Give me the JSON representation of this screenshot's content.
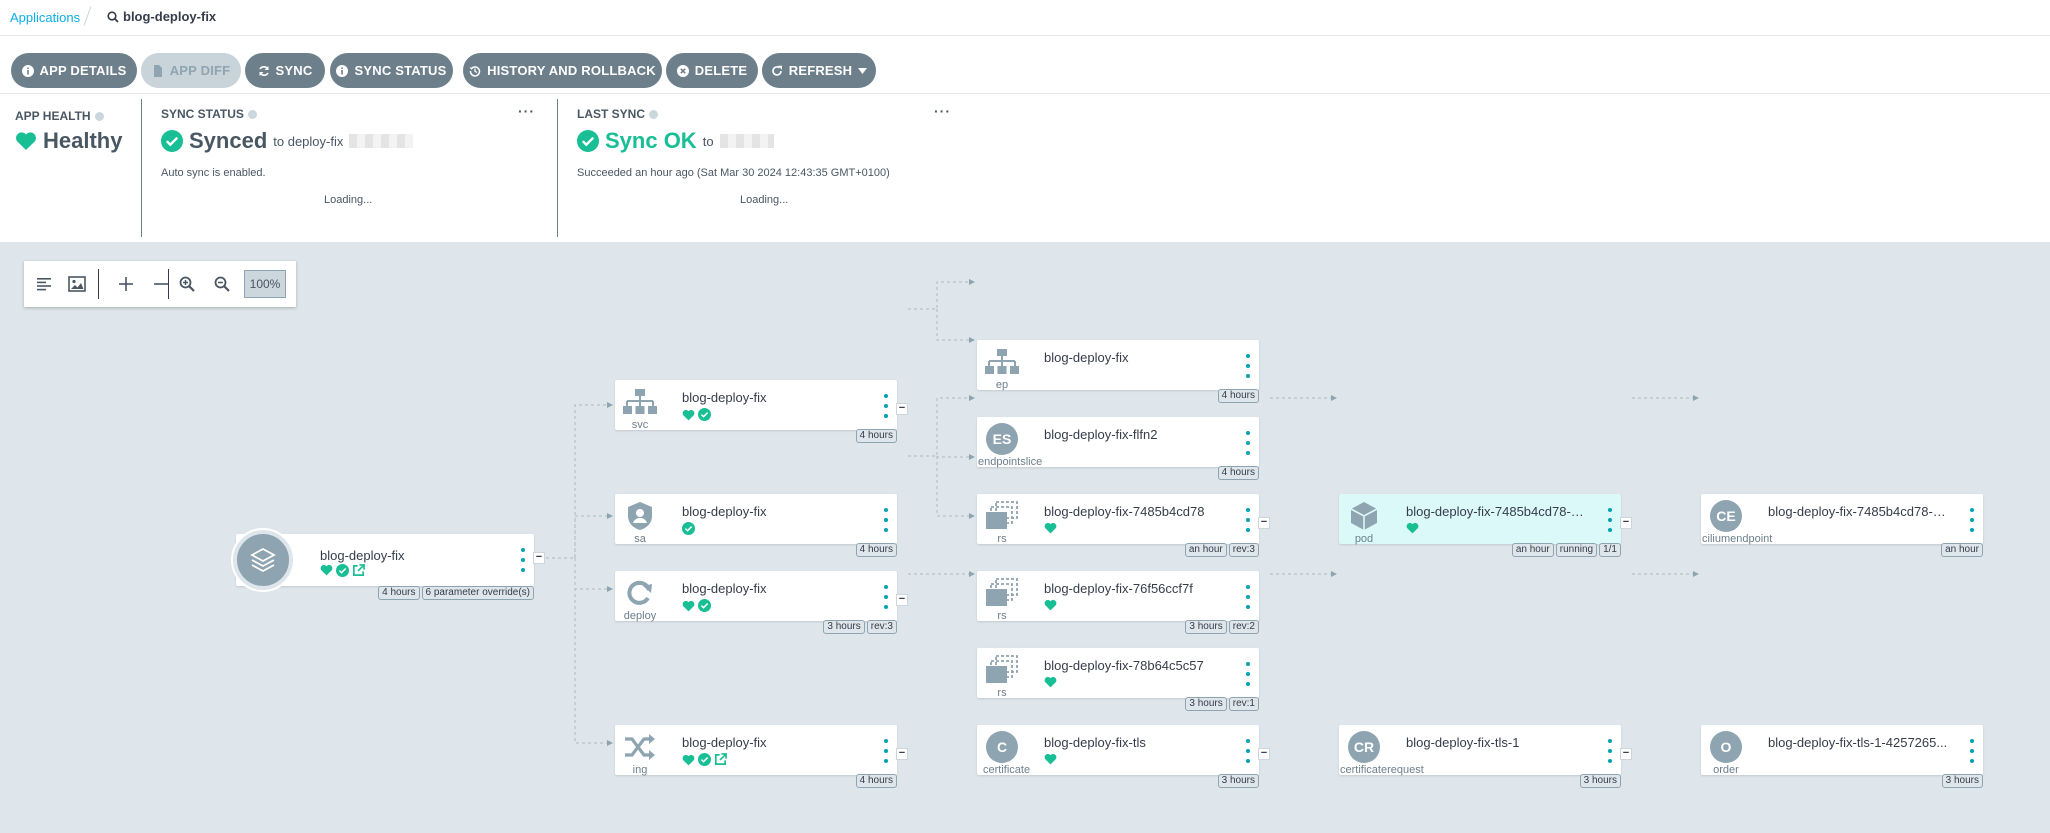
{
  "breadcrumb": {
    "root": "Applications",
    "current": "blog-deploy-fix"
  },
  "toolbar": {
    "app_details": "APP DETAILS",
    "app_diff": "APP DIFF",
    "sync": "SYNC",
    "sync_status": "SYNC STATUS",
    "history": "HISTORY AND ROLLBACK",
    "delete": "DELETE",
    "refresh": "REFRESH"
  },
  "status": {
    "health_title": "APP HEALTH",
    "health_value": "Healthy",
    "sync_title": "SYNC STATUS",
    "sync_value": "Synced",
    "sync_to": "to deploy-fix",
    "auto_sync": "Auto sync is enabled.",
    "sync_loading": "Loading...",
    "last_sync_title": "LAST SYNC",
    "last_sync_value": "Sync OK",
    "last_sync_to": "to",
    "last_sync_detail": "Succeeded an hour ago (Sat Mar 30 2024 12:43:35 GMT+0100)",
    "last_sync_loading": "Loading...",
    "more": "···"
  },
  "zoom": {
    "level": "100%"
  },
  "app_node": {
    "name": "blog-deploy-fix",
    "tags": [
      "4 hours",
      "6 parameter override(s)"
    ]
  },
  "nodes": {
    "svc": {
      "name": "blog-deploy-fix",
      "kind": "svc",
      "tags": [
        "4 hours"
      ]
    },
    "sa": {
      "name": "blog-deploy-fix",
      "kind": "sa",
      "tags": [
        "4 hours"
      ]
    },
    "deploy": {
      "name": "blog-deploy-fix",
      "kind": "deploy",
      "tags": [
        "3 hours",
        "rev:3"
      ]
    },
    "ing": {
      "name": "blog-deploy-fix",
      "kind": "ing",
      "tags": [
        "4 hours"
      ]
    },
    "ep": {
      "name": "blog-deploy-fix",
      "kind": "ep",
      "tags": [
        "4 hours"
      ]
    },
    "eps": {
      "name": "blog-deploy-fix-flfn2",
      "kind": "endpointslice",
      "letter": "ES",
      "tags": [
        "4 hours"
      ]
    },
    "rs1": {
      "name": "blog-deploy-fix-7485b4cd78",
      "kind": "rs",
      "tags": [
        "an hour",
        "rev:3"
      ]
    },
    "rs2": {
      "name": "blog-deploy-fix-76f56ccf7f",
      "kind": "rs",
      "tags": [
        "3 hours",
        "rev:2"
      ]
    },
    "rs3": {
      "name": "blog-deploy-fix-78b64c5c57",
      "kind": "rs",
      "tags": [
        "3 hours",
        "rev:1"
      ]
    },
    "cert": {
      "name": "blog-deploy-fix-tls",
      "kind": "certificate",
      "letter": "C",
      "tags": [
        "3 hours"
      ]
    },
    "pod": {
      "name": "blog-deploy-fix-7485b4cd78-g...",
      "kind": "pod",
      "tags": [
        "an hour",
        "running",
        "1/1"
      ]
    },
    "certreq": {
      "name": "blog-deploy-fix-tls-1",
      "kind": "certificaterequest",
      "letter": "CR",
      "tags": [
        "3 hours"
      ]
    },
    "cep": {
      "name": "blog-deploy-fix-7485b4cd78-g...",
      "kind": "ciliumendpoint",
      "letter": "CE",
      "tags": [
        "an hour"
      ]
    },
    "order": {
      "name": "blog-deploy-fix-tls-1-4257265...",
      "kind": "order",
      "letter": "O",
      "tags": [
        "3 hours"
      ]
    }
  },
  "colors": {
    "healthy": "#18be94",
    "accent": "#0dadea",
    "button": "#6d7f8b",
    "kebab": "#00a2b3"
  }
}
